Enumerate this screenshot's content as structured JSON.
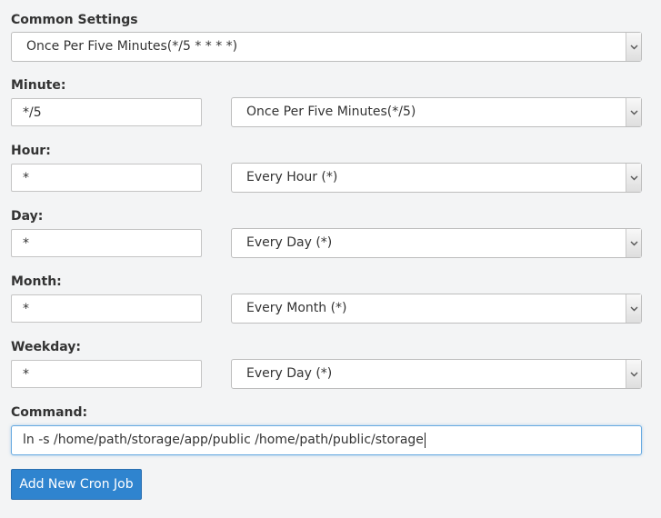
{
  "form": {
    "common_settings": {
      "label": "Common Settings",
      "selected": "Once Per Five Minutes(*/5 * * * *)"
    },
    "minute": {
      "label": "Minute:",
      "value": "*/5",
      "selected": "Once Per Five Minutes(*/5)"
    },
    "hour": {
      "label": "Hour:",
      "value": "*",
      "selected": "Every Hour (*)"
    },
    "day": {
      "label": "Day:",
      "value": "*",
      "selected": "Every Day (*)"
    },
    "month": {
      "label": "Month:",
      "value": "*",
      "selected": "Every Month (*)"
    },
    "weekday": {
      "label": "Weekday:",
      "value": "*",
      "selected": "Every Day (*)"
    },
    "command": {
      "label": "Command:",
      "value": "ln -s /home/path/storage/app/public /home/path/public/storage"
    },
    "submit_label": "Add New Cron Job"
  },
  "icons": {
    "select_caret": "chevron-down-icon"
  },
  "colors": {
    "background": "#f3f4f5",
    "button": "#2f84cf",
    "focus_border": "#66a9e0"
  }
}
